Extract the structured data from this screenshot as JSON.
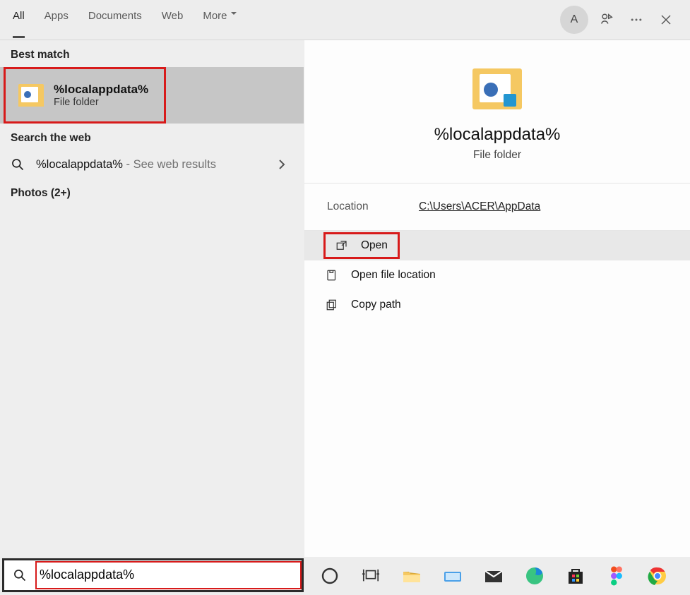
{
  "tabs": {
    "items": [
      "All",
      "Apps",
      "Documents",
      "Web",
      "More"
    ],
    "active_index": 0,
    "avatar_letter": "A"
  },
  "sections": {
    "best_match": "Best match",
    "search_web": "Search the web",
    "photos": "Photos (2+)"
  },
  "best_match": {
    "title": "%localappdata%",
    "subtitle": "File folder"
  },
  "web_result": {
    "query": "%localappdata%",
    "suffix": " - See web results"
  },
  "preview": {
    "title": "%localappdata%",
    "subtitle": "File folder",
    "location_label": "Location",
    "location_value": "C:\\Users\\ACER\\AppData"
  },
  "actions": {
    "open": "Open",
    "open_location": "Open file location",
    "copy_path": "Copy path"
  },
  "search": {
    "value": "%localappdata%"
  }
}
